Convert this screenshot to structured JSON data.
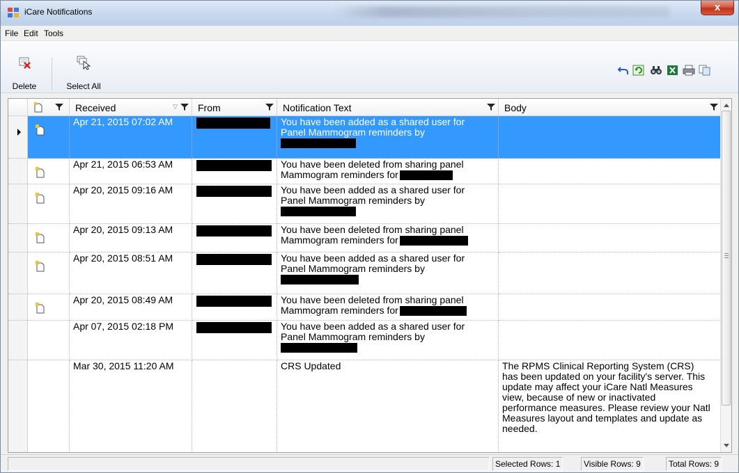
{
  "window": {
    "title": "iCare Notifications",
    "close_glyph": "x"
  },
  "menu": [
    "File",
    "Edit",
    "Tools"
  ],
  "toolbar": {
    "delete_label": "Delete",
    "select_all_label": "Select All"
  },
  "columns": {
    "received": "Received",
    "from": "From",
    "notification_text": "Notification Text",
    "body": "Body"
  },
  "rows": [
    {
      "received": "Apr 21, 2015 07:02 AM",
      "text_line1": "You have been added as a shared user for",
      "text_line2": "Panel Mammogram reminders by",
      "body": "",
      "selected": true,
      "unread": true
    },
    {
      "received": "Apr 21, 2015 06:53 AM",
      "text_line1": "You have been deleted from sharing panel",
      "text_line2": "Mammogram reminders for",
      "body": "",
      "selected": false,
      "unread": true
    },
    {
      "received": "Apr 20, 2015 09:16 AM",
      "text_line1": "You have been added as a shared user for",
      "text_line2": "Panel Mammogram reminders by",
      "body": "",
      "selected": false,
      "unread": true
    },
    {
      "received": "Apr 20, 2015 09:13 AM",
      "text_line1": "You have been deleted from sharing panel",
      "text_line2": "Mammogram reminders for",
      "body": "",
      "selected": false,
      "unread": true
    },
    {
      "received": "Apr 20, 2015 08:51 AM",
      "text_line1": "You have been added as a shared user for",
      "text_line2": "Panel Mammogram reminders by",
      "body": "",
      "selected": false,
      "unread": true
    },
    {
      "received": "Apr 20, 2015 08:49 AM",
      "text_line1": "You have been deleted from sharing panel",
      "text_line2": "Mammogram reminders for",
      "body": "",
      "selected": false,
      "unread": true
    },
    {
      "received": "Apr 07, 2015 02:18 PM",
      "text_line1": "You have been added as a shared user for",
      "text_line2": "Panel Mammogram reminders by",
      "body": "",
      "selected": false,
      "unread": false
    },
    {
      "received": "Mar 30, 2015 11:20 AM",
      "text_line1": "CRS Updated",
      "text_line2": "",
      "body": "The RPMS Clinical Reporting System (CRS) has been updated on your facility's server. This update may affect your iCare Natl Measures view, because of new or inactivated performance measures. Please review your Natl Measures layout and templates and update as needed.",
      "selected": false,
      "unread": false
    }
  ],
  "status": {
    "selected": "Selected Rows: 1",
    "visible": "Visible Rows: 9",
    "total": "Total Rows: 9"
  },
  "colors": {
    "selection": "#3399ff",
    "title_gradient": "#c9d9ee"
  }
}
